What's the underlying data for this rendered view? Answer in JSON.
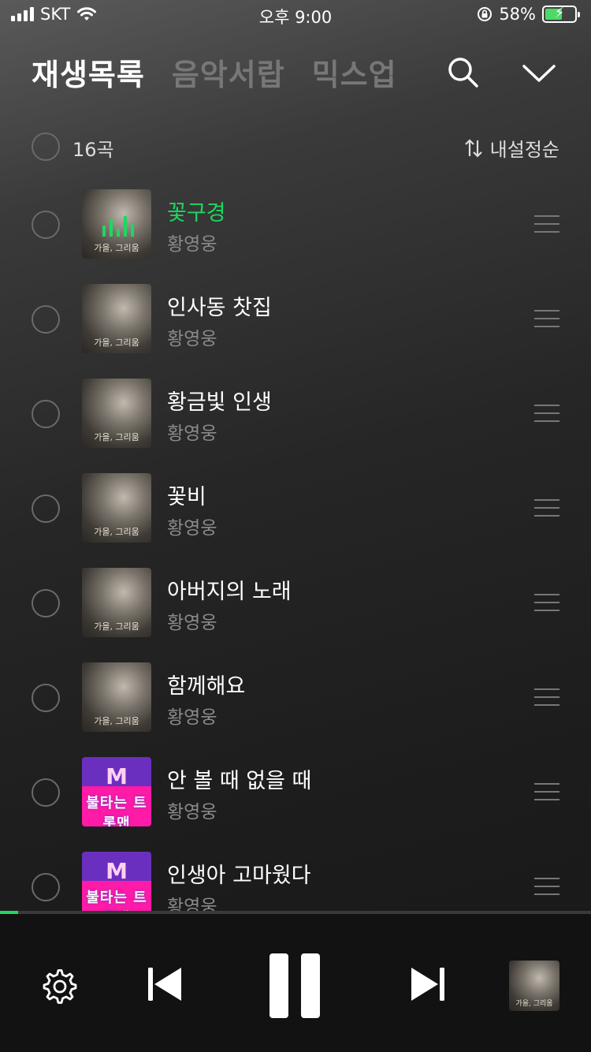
{
  "status_bar": {
    "carrier": "SKT",
    "time": "오후 9:00",
    "battery_percent": "58%",
    "battery_level": 0.58
  },
  "tabs": [
    {
      "label": "재생목록",
      "active": true
    },
    {
      "label": "음악서랍",
      "active": false
    },
    {
      "label": "믹스업",
      "active": false
    }
  ],
  "list_header": {
    "count": "16곡",
    "sort_label": "내설정순"
  },
  "songs": [
    {
      "title": "꽃구경",
      "artist": "황영웅",
      "playing": true,
      "album_caption": "가을, 그리움"
    },
    {
      "title": "인사동 찻집",
      "artist": "황영웅",
      "playing": false,
      "album_caption": "가을, 그리움"
    },
    {
      "title": "황금빛 인생",
      "artist": "황영웅",
      "playing": false,
      "album_caption": "가을, 그리움"
    },
    {
      "title": "꽃비",
      "artist": "황영웅",
      "playing": false,
      "album_caption": "가을, 그리움"
    },
    {
      "title": "아버지의 노래",
      "artist": "황영웅",
      "playing": false,
      "album_caption": "가을, 그리움"
    },
    {
      "title": "함께해요",
      "artist": "황영웅",
      "playing": false,
      "album_caption": "가을, 그리움"
    },
    {
      "title": "안 볼 때 없을 때",
      "artist": "황영웅",
      "playing": false,
      "album_caption": "불타는 트롯맨"
    },
    {
      "title": "인생아 고마웠다",
      "artist": "황영웅",
      "playing": false,
      "album_caption": "불타는 트롯맨"
    }
  ],
  "player": {
    "progress": 0.03,
    "mini_album_caption": "가을, 그리움"
  },
  "colors": {
    "accent": "#1ed760",
    "brand_pink": "#ff1aa8",
    "brand_purple": "#6b2fbf"
  }
}
